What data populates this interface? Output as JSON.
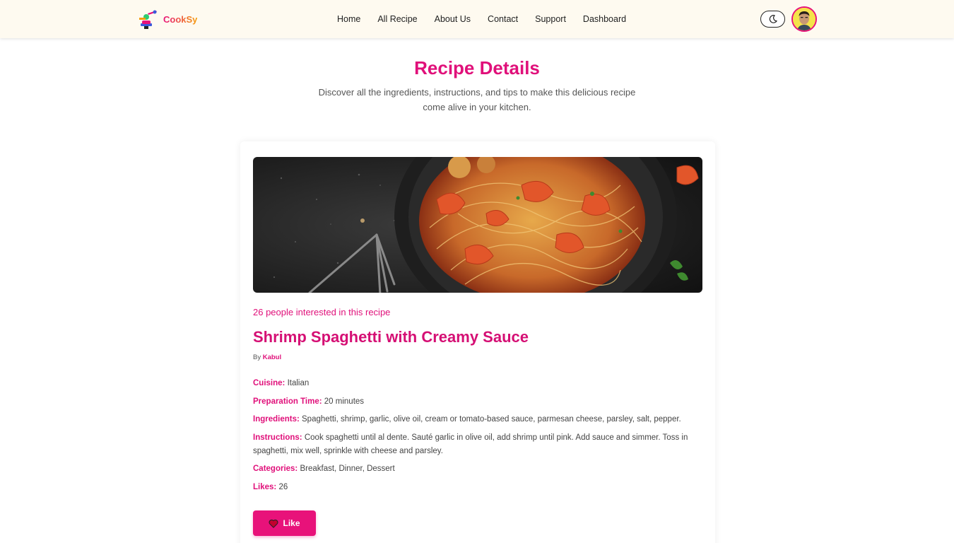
{
  "brand": {
    "name": "CookSy",
    "logo_icon": "chef-cooking-icon"
  },
  "nav": {
    "links": [
      "Home",
      "All Recipe",
      "About Us",
      "Contact",
      "Support",
      "Dashboard"
    ]
  },
  "controls": {
    "theme_icon": "moon-icon",
    "avatar": "user-avatar"
  },
  "header": {
    "title": "Recipe Details",
    "subtitle": "Discover all the ingredients, instructions, and tips to make this delicious recipe come alive in your kitchen."
  },
  "recipe": {
    "image": "shrimp-spaghetti-photo",
    "interest_text": "26 people interested in this recipe",
    "title": "Shrimp Spaghetti with Creamy Sauce",
    "by_label": "By",
    "author": "Kabul",
    "details": [
      {
        "label": "Cuisine:",
        "value": "Italian"
      },
      {
        "label": "Preparation Time:",
        "value": "20 minutes"
      },
      {
        "label": "Ingredients:",
        "value": "Spaghetti, shrimp, garlic, olive oil, cream or tomato-based sauce, parmesan cheese, parsley, salt, pepper."
      },
      {
        "label": "Instructions:",
        "value": "Cook spaghetti until al dente. Sauté garlic in olive oil, add shrimp until pink. Add sauce and simmer. Toss in spaghetti, mix well, sprinkle with cheese and parsley."
      },
      {
        "label": "Categories:",
        "value": "Breakfast, Dinner, Dessert"
      },
      {
        "label": "Likes:",
        "value": "26"
      }
    ],
    "like_button": {
      "label": "Like",
      "icon": "heart-icon"
    }
  },
  "colors": {
    "accent": "#e0107a",
    "button": "#e8127a",
    "navbar_bg": "#fefaf0"
  }
}
